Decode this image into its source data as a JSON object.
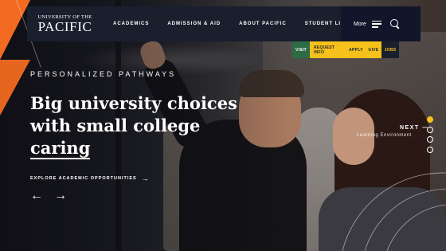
{
  "logo": {
    "small": "UNIVERSITY OF THE",
    "big": "PACIFIC"
  },
  "nav": {
    "links": [
      "ACADEMICS",
      "ADMISSION & AID",
      "ABOUT PACIFIC",
      "STUDENT LIFE"
    ],
    "more": "More"
  },
  "utility": [
    "VISIT",
    "REQUEST INFO",
    "APPLY",
    "GIVE",
    "JOBS"
  ],
  "hero": {
    "eyebrow": "PERSONALIZED PATHWAYS",
    "headline": [
      "Big university choices",
      "with small college",
      "caring"
    ],
    "cta": "EXPLORE ACADEMIC OPPORTUNITIES",
    "prev_icon": "arrow-left-icon",
    "next_icon": "arrow-right-icon"
  },
  "next": {
    "label": "NEXT —",
    "title": "Learning Environment"
  },
  "slides": {
    "count": 4,
    "active": 1
  },
  "colors": {
    "navy": "#1a1f2e",
    "orange": "#f26b21",
    "gold": "#f5c11a",
    "green": "#2d6b45"
  }
}
